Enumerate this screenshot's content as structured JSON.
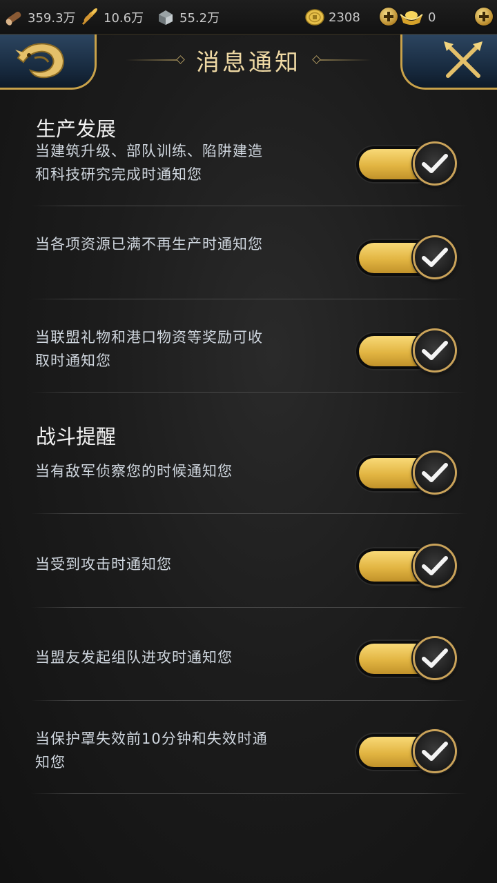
{
  "resources": {
    "wood": "359.3万",
    "food": "10.6万",
    "stone": "55.2万",
    "coins": "2308",
    "ingots": "0"
  },
  "header": {
    "title": "消息通知"
  },
  "sections": [
    {
      "title": "生产发展",
      "items": [
        {
          "text": "当建筑升级、部队训练、陷阱建造和科技研究完成时通知您",
          "enabled": true
        },
        {
          "text": "当各项资源已满不再生产时通知您",
          "enabled": true
        },
        {
          "text": "当联盟礼物和港口物资等奖励可收取时通知您",
          "enabled": true
        }
      ]
    },
    {
      "title": "战斗提醒",
      "items": [
        {
          "text": "当有敌军侦察您的时候通知您",
          "enabled": true
        },
        {
          "text": "当受到攻击时通知您",
          "enabled": true
        },
        {
          "text": "当盟友发起组队进攻时通知您",
          "enabled": true
        },
        {
          "text": "当保护罩失效前10分钟和失效时通知您",
          "enabled": true
        }
      ]
    }
  ],
  "colors": {
    "accent_gold": "#e2b542",
    "title_gold": "#efd9a4"
  }
}
